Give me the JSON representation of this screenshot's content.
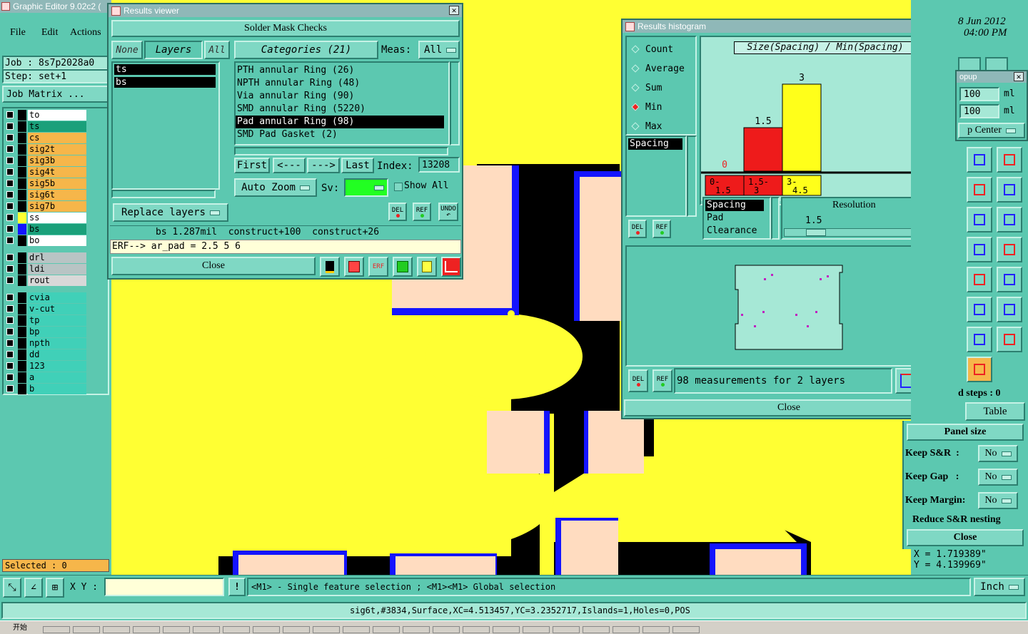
{
  "app": {
    "title": "Graphic Editor 9.02c2 (",
    "menu": [
      "File",
      "Edit",
      "Actions"
    ],
    "job_label": "Job : 8s7p2028a0",
    "step_label": "Step: set+1",
    "job_matrix": "Job Matrix ...",
    "selected": "Selected : 0",
    "date": "8 Jun 2012",
    "time": "04:00 PM",
    "xy_label": "X Y :",
    "hint": "<M1> - Single feature selection ; <M1><M1> Global selection",
    "units": "Inch",
    "status": "sig6t,#3834,Surface,XC=4.513457,YC=3.2352717,Islands=1,Holes=0,POS",
    "coord_x": "X = 1.719389\"",
    "coord_y": "Y = 4.139969\""
  },
  "layers": [
    {
      "name": "to",
      "color": "#ffffff"
    },
    {
      "name": "ts",
      "color": "#1aa07a"
    },
    {
      "name": "cs",
      "color": "#f6b64a"
    },
    {
      "name": "sig2t",
      "color": "#f6b64a"
    },
    {
      "name": "sig3b",
      "color": "#f6b64a"
    },
    {
      "name": "sig4t",
      "color": "#f6b64a"
    },
    {
      "name": "sig5b",
      "color": "#f6b64a"
    },
    {
      "name": "sig6t",
      "color": "#f6b64a"
    },
    {
      "name": "sig7b",
      "color": "#f6b64a"
    },
    {
      "name": "ss",
      "color": "#ffffff"
    },
    {
      "name": "bs",
      "color": "#1aa07a"
    },
    {
      "name": "bo",
      "color": "#ffffff"
    },
    {
      "name": "drl",
      "color": "#b8c4c4"
    },
    {
      "name": "ldi",
      "color": "#b8c4c4"
    },
    {
      "name": "rout",
      "color": "#d8d8d8"
    },
    {
      "name": "cvia",
      "color": "#40d0b8"
    },
    {
      "name": "v-cut",
      "color": "#40d0b8"
    },
    {
      "name": "tp",
      "color": "#40d0b8"
    },
    {
      "name": "bp",
      "color": "#40d0b8"
    },
    {
      "name": "npth",
      "color": "#40d0b8"
    },
    {
      "name": "dd",
      "color": "#40d0b8"
    },
    {
      "name": "123",
      "color": "#40d0b8"
    },
    {
      "name": "a",
      "color": "#40d0b8"
    },
    {
      "name": "b",
      "color": "#40d0b8"
    }
  ],
  "results_viewer": {
    "title": "Results viewer",
    "header": "Solder Mask Checks",
    "tabs": [
      "None",
      "Layers",
      "All"
    ],
    "categories_label": "Categories (21)",
    "meas_label": "Meas:",
    "meas_value": "All",
    "layers": [
      "ts",
      "bs"
    ],
    "categories": [
      "PTH annular Ring (26)",
      "NPTH annular Ring (48)",
      "Via annular Ring (90)",
      "SMD annular Ring (5220)",
      "Pad annular Ring (98)",
      "SMD Pad Gasket (2)"
    ],
    "nav": [
      "First",
      "<---",
      "--->",
      "Last"
    ],
    "index_label": "Index:",
    "index_value": "13208",
    "auto_zoom": "Auto Zoom",
    "sv_label": "Sv:",
    "show_all": "Show All",
    "replace_layers": "Replace layers",
    "del": "DEL",
    "ref": "REF",
    "undo": "UNDO",
    "info": "bs 1.287mil  construct+100  construct+26",
    "erf": "ERF--> ar_pad = 2.5 5 6",
    "close": "Close"
  },
  "histogram": {
    "title": "Results histogram",
    "options": [
      "Count",
      "Average",
      "Sum",
      "Min",
      "Max"
    ],
    "selected_option": "Min",
    "chart_title": "Size(Spacing) / Min(Spacing)",
    "list_item": "Spacing",
    "spacing_items": [
      "Spacing",
      "Pad",
      "Clearance"
    ],
    "resolution_label": "Resolution",
    "resolution_value": "1.5",
    "measurements": "98 measurements for 2 layers",
    "close": "Close",
    "del": "DEL",
    "ref": "REF"
  },
  "chart_data": {
    "type": "bar",
    "title": "Size(Spacing) / Min(Spacing)",
    "categories": [
      "0-1.5",
      "1.5-3",
      "3-4.5"
    ],
    "category_labels": [
      [
        "0-",
        "1.5"
      ],
      [
        "1.5-",
        "3"
      ],
      [
        "3-",
        "4.5"
      ]
    ],
    "values": [
      0,
      1.5,
      3
    ],
    "value_labels": [
      "0",
      "1.5",
      "3"
    ],
    "colors": [
      "#ee1b1b",
      "#ee1b1b",
      "#ffff1a"
    ],
    "ylim": [
      0,
      3
    ]
  },
  "popup": {
    "title": "opup",
    "val1": "100",
    "val2": "100",
    "unit": "ml",
    "center": "p Center"
  },
  "panel": {
    "steps": "d steps : 0",
    "table": "Table",
    "panel_size": "Panel size",
    "keep_sr_label": "Keep S&R  :",
    "keep_sr": "No",
    "keep_gap_label": "Keep Gap   :",
    "keep_gap": "No",
    "keep_margin_label": "Keep Margin:",
    "keep_margin": "No",
    "reduce": "Reduce S&R nesting",
    "close": "Close"
  },
  "taskbar": {
    "start": "开始"
  }
}
